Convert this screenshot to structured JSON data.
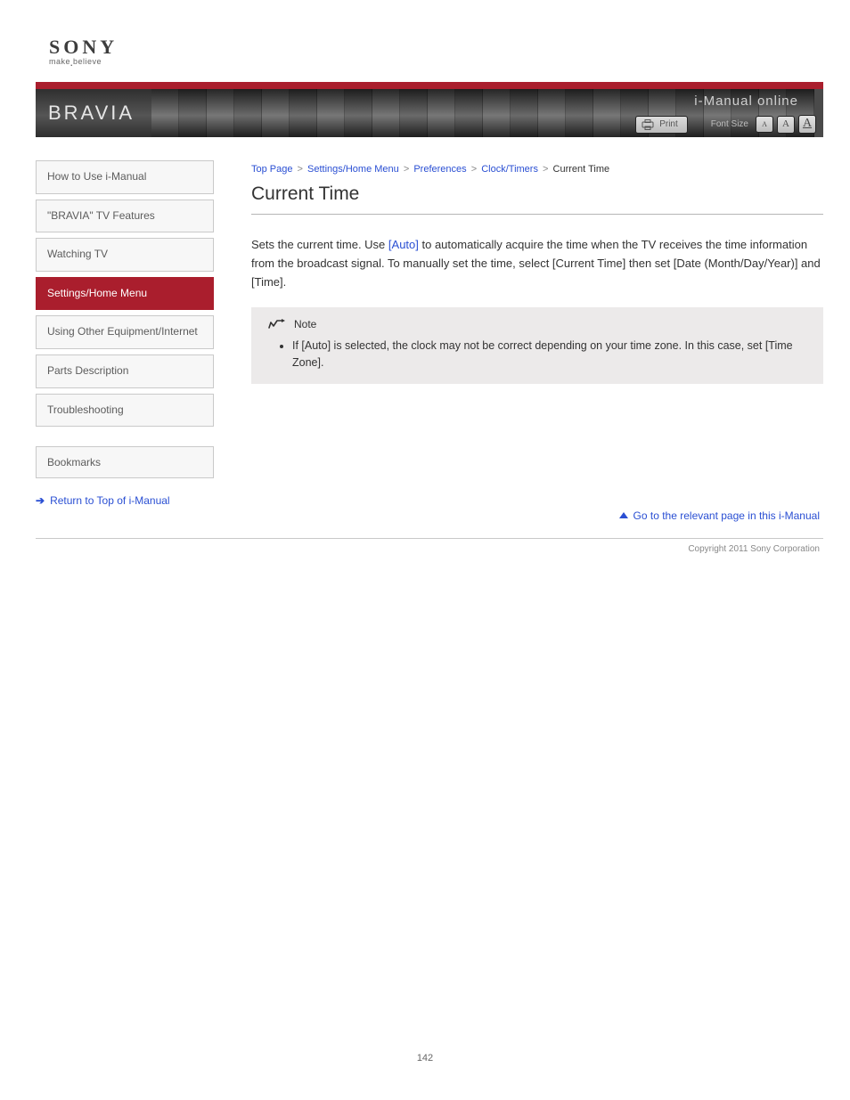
{
  "brand": {
    "name": "SONY",
    "tagline_a": "make",
    "tagline_b": "believe",
    "product": "BRAVIA",
    "guide": "i-Manual online"
  },
  "header": {
    "print": "Print",
    "font_size": "Font Size"
  },
  "nav": [
    {
      "label": "How to Use i-Manual"
    },
    {
      "label": "\"BRAVIA\" TV Features"
    },
    {
      "label": "Watching TV"
    },
    {
      "label": "Settings/Home Menu"
    },
    {
      "label": "Using Other Equipment/Internet"
    },
    {
      "label": "Parts Description"
    },
    {
      "label": "Troubleshooting"
    }
  ],
  "active_nav_index": 3,
  "bookmarks": "Bookmarks",
  "imanual_link": "Return to Top of i-Manual",
  "breadcrumb": {
    "a": "Top Page",
    "b": "Settings/Home Menu",
    "c": "Preferences",
    "d": "Clock/Timers",
    "current": "Current Time"
  },
  "article": {
    "title": "Current Time",
    "body": "Sets the current time. Use to automatically acquire the time when the TV receives the time information from the broadcast signal. To manually set the time, select [Current Time] then set [Date (Month/Day/Year)] and [Time].",
    "link_inline": "[Auto]",
    "note_head": "Note",
    "note_item": "If [Auto] is selected, the clock may not be correct depending on your time zone. In this case, set [Time Zone]."
  },
  "go_top": "Go to the relevant page in this i-Manual",
  "copyright": "Copyright 2011 Sony Corporation",
  "page_number": "142"
}
